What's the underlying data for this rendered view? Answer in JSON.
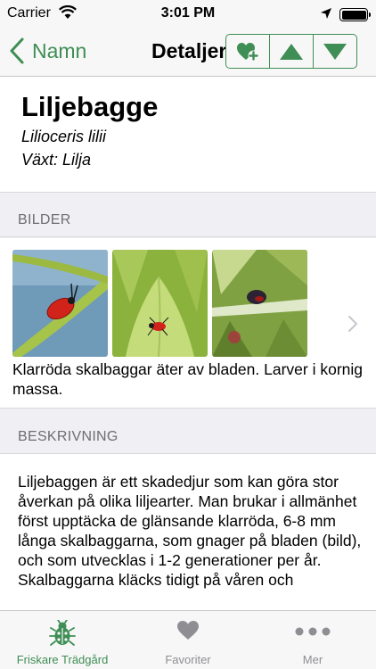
{
  "status_bar": {
    "carrier": "Carrier",
    "time": "3:01 PM"
  },
  "nav": {
    "back_label": "Namn",
    "title": "Detaljer",
    "buttons": [
      "add-favorite-icon",
      "previous-icon",
      "next-icon"
    ]
  },
  "species": {
    "name": "Liljebagge",
    "latin": "Lilioceris lilii",
    "plant": "Växt: Lilja"
  },
  "images_section": {
    "header": "BILDER",
    "caption": "Klarröda skalbaggar äter av bladen. Larver i kornig massa."
  },
  "description_section": {
    "header": "BESKRIVNING",
    "text": "Liljebaggen är ett skadedjur som kan göra stor åverkan på olika liljearter. Man brukar i allmänhet först upptäcka de glänsande klarröda, 6-8 mm långa skalbaggarna, som gnager på bladen (bild), och som utvecklas i 1-2 generationer per år.\nSkalbaggarna kläcks tidigt på våren och"
  },
  "tabs": [
    {
      "label": "Friskare Trädgård",
      "icon": "beetle-icon",
      "active": true
    },
    {
      "label": "Favoriter",
      "icon": "heart-icon",
      "active": false
    },
    {
      "label": "Mer",
      "icon": "more-icon",
      "active": false
    }
  ],
  "colors": {
    "accent": "#3f8e55",
    "inactive": "#8e8e93",
    "background": "#efeff4"
  }
}
